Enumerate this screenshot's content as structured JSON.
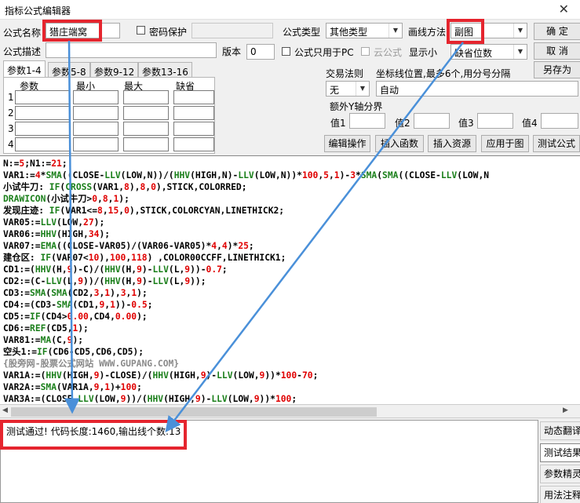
{
  "window": {
    "title": "指标公式编辑器"
  },
  "header": {
    "name_label": "公式名称",
    "name_value": "猎庄端窝",
    "password_label": "密码保护",
    "type_label": "公式类型",
    "type_value": "其他类型",
    "draw_label": "画线方法",
    "draw_value": "副图",
    "desc_label": "公式描述",
    "version_label": "版本",
    "version_value": "0",
    "pc_only_label": "公式只用于PC",
    "cloud_label": "云公式",
    "show_label": "显示小",
    "default_pos_value": "缺省位数"
  },
  "buttons": {
    "ok": "确 定",
    "cancel": "取 消",
    "save_as": "另存为",
    "edit_ops": "编辑操作",
    "insert_func": "插入函数",
    "insert_res": "插入资源",
    "apply_chart": "应用于图",
    "test_formula": "测试公式"
  },
  "tabs": [
    "参数1-4",
    "参数5-8",
    "参数9-12",
    "参数13-16"
  ],
  "param_table": {
    "headers": [
      "参数",
      "最小",
      "最大",
      "缺省"
    ],
    "rows": [
      "1",
      "2",
      "3",
      "4"
    ]
  },
  "trade": {
    "rule_label": "交易法则",
    "rule_value": "无",
    "coord_label": "坐标线位置,最多6个,用分号分隔",
    "coord_value": "自动"
  },
  "yaxis": {
    "group_label": "额外Y轴分界",
    "v1": "值1",
    "v2": "值2",
    "v3": "值3",
    "v4": "值4"
  },
  "code_lines": [
    [
      [
        "N:=",
        "#000"
      ],
      [
        "5",
        "#e00000"
      ],
      [
        ";N1:=",
        "#000"
      ],
      [
        "21",
        "#e00000"
      ],
      [
        ";",
        "#000"
      ]
    ],
    [
      [
        "VAR1:=",
        "#000"
      ],
      [
        "4",
        "#e00000"
      ],
      [
        "*",
        "#000"
      ],
      [
        "SMA",
        "#1a7f1a"
      ],
      [
        "((CLOSE-",
        "#000"
      ],
      [
        "LLV",
        "#1a7f1a"
      ],
      [
        "(LOW,N))/(",
        "#000"
      ],
      [
        "HHV",
        "#1a7f1a"
      ],
      [
        "(HIGH,N)-",
        "#000"
      ],
      [
        "LLV",
        "#1a7f1a"
      ],
      [
        "(LOW,N))*",
        "#000"
      ],
      [
        "100",
        "#e00000"
      ],
      [
        ",",
        "#000"
      ],
      [
        "5",
        "#e00000"
      ],
      [
        ",",
        "#000"
      ],
      [
        "1",
        "#e00000"
      ],
      [
        ")-",
        "#000"
      ],
      [
        "3",
        "#e00000"
      ],
      [
        "*",
        "#000"
      ],
      [
        "SMA",
        "#1a7f1a"
      ],
      [
        "(",
        "#000"
      ],
      [
        "SMA",
        "#1a7f1a"
      ],
      [
        "((CLOSE-",
        "#000"
      ],
      [
        "LLV",
        "#1a7f1a"
      ],
      [
        "(LOW,N",
        "#000"
      ]
    ],
    [
      [
        "小试牛刀: ",
        "#000"
      ],
      [
        "IF",
        "#1a7f1a"
      ],
      [
        "(",
        "#000"
      ],
      [
        "CROSS",
        "#1a7f1a"
      ],
      [
        "(VAR1,",
        "#000"
      ],
      [
        "8",
        "#e00000"
      ],
      [
        "),",
        "#000"
      ],
      [
        "8",
        "#e00000"
      ],
      [
        ",",
        "#000"
      ],
      [
        "0",
        "#e00000"
      ],
      [
        "),STICK,COLORRED;",
        "#000"
      ]
    ],
    [
      [
        "DRAWICON",
        "#1a7f1a"
      ],
      [
        "(小试牛刀>",
        "#000"
      ],
      [
        "0",
        "#e00000"
      ],
      [
        ",",
        "#000"
      ],
      [
        "8",
        "#e00000"
      ],
      [
        ",",
        "#000"
      ],
      [
        "1",
        "#e00000"
      ],
      [
        ");",
        "#000"
      ]
    ],
    [
      [
        "发现庄迹: ",
        "#000"
      ],
      [
        "IF",
        "#1a7f1a"
      ],
      [
        "(VAR1<=",
        "#000"
      ],
      [
        "8",
        "#e00000"
      ],
      [
        ",",
        "#000"
      ],
      [
        "15",
        "#e00000"
      ],
      [
        ",",
        "#000"
      ],
      [
        "0",
        "#e00000"
      ],
      [
        "),STICK,COLORCYAN,LINETHICK2;",
        "#000"
      ]
    ],
    [
      [
        "VAR05:=",
        "#000"
      ],
      [
        "LLV",
        "#1a7f1a"
      ],
      [
        "(LOW,",
        "#000"
      ],
      [
        "27",
        "#e00000"
      ],
      [
        ");",
        "#000"
      ]
    ],
    [
      [
        "VAR06:=",
        "#000"
      ],
      [
        "HHV",
        "#1a7f1a"
      ],
      [
        "(HIGH,",
        "#000"
      ],
      [
        "34",
        "#e00000"
      ],
      [
        ");",
        "#000"
      ]
    ],
    [
      [
        "VAR07:=",
        "#000"
      ],
      [
        "EMA",
        "#1a7f1a"
      ],
      [
        "((CLOSE-VAR05)/(VAR06-VAR05)*",
        "#000"
      ],
      [
        "4",
        "#e00000"
      ],
      [
        ",",
        "#000"
      ],
      [
        "4",
        "#e00000"
      ],
      [
        ")*",
        "#000"
      ],
      [
        "25",
        "#e00000"
      ],
      [
        ";",
        "#000"
      ]
    ],
    [
      [
        "建仓区: ",
        "#000"
      ],
      [
        "IF",
        "#1a7f1a"
      ],
      [
        "(VAR07<",
        "#000"
      ],
      [
        "10",
        "#e00000"
      ],
      [
        "),",
        "#000"
      ],
      [
        "100",
        "#e00000"
      ],
      [
        ",",
        "#000"
      ],
      [
        "118",
        "#e00000"
      ],
      [
        ") ,COLOR00CCFF,LINETHICK1;",
        "#000"
      ]
    ],
    [
      [
        "CD1:=(",
        "#000"
      ],
      [
        "HHV",
        "#1a7f1a"
      ],
      [
        "(H,",
        "#000"
      ],
      [
        "9",
        "#e00000"
      ],
      [
        ")-C)/(",
        "#000"
      ],
      [
        "HHV",
        "#1a7f1a"
      ],
      [
        "(H,",
        "#000"
      ],
      [
        "9",
        "#e00000"
      ],
      [
        ")-",
        "#000"
      ],
      [
        "LLV",
        "#1a7f1a"
      ],
      [
        "(L,",
        "#000"
      ],
      [
        "9",
        "#e00000"
      ],
      [
        "))-",
        "#000"
      ],
      [
        "0.7",
        "#e00000"
      ],
      [
        ";",
        "#000"
      ]
    ],
    [
      [
        "CD2:=(C-",
        "#000"
      ],
      [
        "LLV",
        "#1a7f1a"
      ],
      [
        "(L,",
        "#000"
      ],
      [
        "9",
        "#e00000"
      ],
      [
        "))/(",
        "#000"
      ],
      [
        "HHV",
        "#1a7f1a"
      ],
      [
        "(H,",
        "#000"
      ],
      [
        "9",
        "#e00000"
      ],
      [
        ")-",
        "#000"
      ],
      [
        "LLV",
        "#1a7f1a"
      ],
      [
        "(L,",
        "#000"
      ],
      [
        "9",
        "#e00000"
      ],
      [
        "));",
        "#000"
      ]
    ],
    [
      [
        "CD3:=",
        "#000"
      ],
      [
        "SMA",
        "#1a7f1a"
      ],
      [
        "(",
        "#000"
      ],
      [
        "SMA",
        "#1a7f1a"
      ],
      [
        "(CD2,",
        "#000"
      ],
      [
        "3",
        "#e00000"
      ],
      [
        ",",
        "#000"
      ],
      [
        "1",
        "#e00000"
      ],
      [
        "),",
        "#000"
      ],
      [
        "3",
        "#e00000"
      ],
      [
        ",",
        "#000"
      ],
      [
        "1",
        "#e00000"
      ],
      [
        ");",
        "#000"
      ]
    ],
    [
      [
        "CD4:=(CD3-",
        "#000"
      ],
      [
        "SMA",
        "#1a7f1a"
      ],
      [
        "(CD1,",
        "#000"
      ],
      [
        "9",
        "#e00000"
      ],
      [
        ",",
        "#000"
      ],
      [
        "1",
        "#e00000"
      ],
      [
        "))-",
        "#000"
      ],
      [
        "0.5",
        "#e00000"
      ],
      [
        ";",
        "#000"
      ]
    ],
    [
      [
        "CD5:=",
        "#000"
      ],
      [
        "IF",
        "#1a7f1a"
      ],
      [
        "(CD4>",
        "#000"
      ],
      [
        "0.00",
        "#e00000"
      ],
      [
        ",CD4,",
        "#000"
      ],
      [
        "0.00",
        "#e00000"
      ],
      [
        ");",
        "#000"
      ]
    ],
    [
      [
        "CD6:=",
        "#000"
      ],
      [
        "REF",
        "#1a7f1a"
      ],
      [
        "(CD5,",
        "#000"
      ],
      [
        "1",
        "#e00000"
      ],
      [
        ");",
        "#000"
      ]
    ],
    [
      [
        "VAR81:=",
        "#000"
      ],
      [
        "MA",
        "#1a7f1a"
      ],
      [
        "(C,",
        "#000"
      ],
      [
        "9",
        "#e00000"
      ],
      [
        ");",
        "#000"
      ]
    ],
    [
      [
        "空头1:=",
        "#000"
      ],
      [
        "IF",
        "#1a7f1a"
      ],
      [
        "(CD6-CD5,CD6,CD5);",
        "#000"
      ]
    ],
    [
      [
        "{股旁网-股票公式网站 WWW.GUPANG.COM}",
        "#8a8a8a"
      ]
    ],
    [
      [
        "VAR1A:=(",
        "#000"
      ],
      [
        "HHV",
        "#1a7f1a"
      ],
      [
        "(HIGH,",
        "#000"
      ],
      [
        "9",
        "#e00000"
      ],
      [
        ")-CLOSE)/(",
        "#000"
      ],
      [
        "HHV",
        "#1a7f1a"
      ],
      [
        "(HIGH,",
        "#000"
      ],
      [
        "9",
        "#e00000"
      ],
      [
        ")-",
        "#000"
      ],
      [
        "LLV",
        "#1a7f1a"
      ],
      [
        "(LOW,",
        "#000"
      ],
      [
        "9",
        "#e00000"
      ],
      [
        "))*",
        "#000"
      ],
      [
        "100",
        "#e00000"
      ],
      [
        "-",
        "#000"
      ],
      [
        "70",
        "#e00000"
      ],
      [
        ";",
        "#000"
      ]
    ],
    [
      [
        "VAR2A:=",
        "#000"
      ],
      [
        "SMA",
        "#1a7f1a"
      ],
      [
        "(VAR1A,",
        "#000"
      ],
      [
        "9",
        "#e00000"
      ],
      [
        ",",
        "#000"
      ],
      [
        "1",
        "#e00000"
      ],
      [
        ")+",
        "#000"
      ],
      [
        "100",
        "#e00000"
      ],
      [
        ";",
        "#000"
      ]
    ],
    [
      [
        "VAR3A:=(CLOSE-",
        "#000"
      ],
      [
        "LLV",
        "#1a7f1a"
      ],
      [
        "(LOW,",
        "#000"
      ],
      [
        "9",
        "#e00000"
      ],
      [
        "))/(",
        "#000"
      ],
      [
        "HHV",
        "#1a7f1a"
      ],
      [
        "(HIGH,",
        "#000"
      ],
      [
        "9",
        "#e00000"
      ],
      [
        ")-",
        "#000"
      ],
      [
        "LLV",
        "#1a7f1a"
      ],
      [
        "(LOW,",
        "#000"
      ],
      [
        "9",
        "#e00000"
      ],
      [
        "))*",
        "#000"
      ],
      [
        "100",
        "#e00000"
      ],
      [
        ";",
        "#000"
      ]
    ]
  ],
  "output_text": "测试通过! 代码长度:1460,输出线个数:13",
  "side_buttons": [
    "动态翻译",
    "测试结果",
    "参数精灵",
    "用法注释"
  ],
  "colors": {
    "highlight": "#e5252e",
    "arrow": "#4a90d9"
  }
}
